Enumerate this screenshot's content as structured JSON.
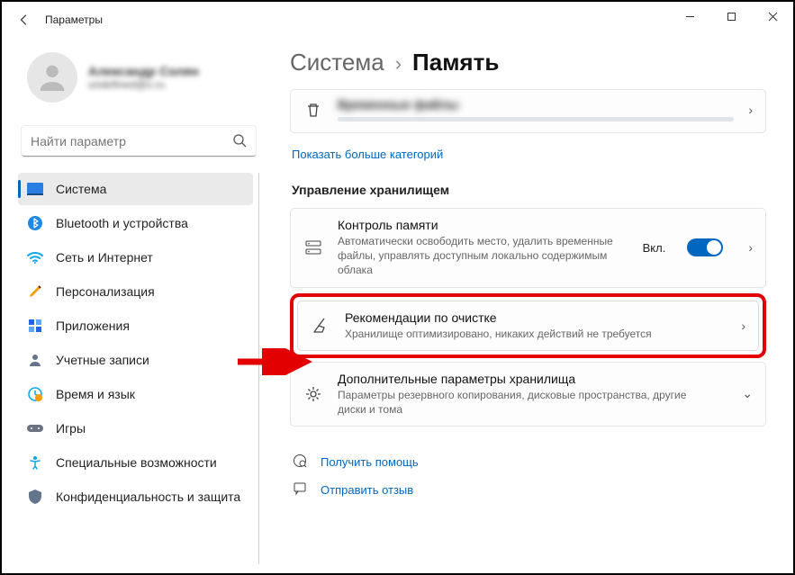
{
  "window": {
    "title": "Параметры"
  },
  "user": {
    "name": "Александр Солян",
    "email": "undefined@x.ru"
  },
  "search": {
    "placeholder": "Найти параметр"
  },
  "nav": [
    {
      "id": "system",
      "label": "Система",
      "active": true
    },
    {
      "id": "bluetooth",
      "label": "Bluetooth и устройства",
      "active": false
    },
    {
      "id": "network",
      "label": "Сеть и Интернет",
      "active": false
    },
    {
      "id": "personalize",
      "label": "Персонализация",
      "active": false
    },
    {
      "id": "apps",
      "label": "Приложения",
      "active": false
    },
    {
      "id": "accounts",
      "label": "Учетные записи",
      "active": false
    },
    {
      "id": "time",
      "label": "Время и язык",
      "active": false
    },
    {
      "id": "gaming",
      "label": "Игры",
      "active": false
    },
    {
      "id": "accessibility",
      "label": "Специальные возможности",
      "active": false
    },
    {
      "id": "privacy",
      "label": "Конфиденциальность и защита",
      "active": false
    }
  ],
  "breadcrumb": {
    "parent": "Система",
    "current": "Память"
  },
  "top_card": {
    "title": "Временные файлы"
  },
  "more_categories": "Показать больше категорий",
  "section_title": "Управление хранилищем",
  "storage_sense": {
    "title": "Контроль памяти",
    "desc": "Автоматически освободить место, удалить временные файлы, управлять доступным локально содержимым облака",
    "state_label": "Вкл."
  },
  "cleanup": {
    "title": "Рекомендации по очистке",
    "desc": "Хранилище оптимизировано, никаких действий не требуется"
  },
  "advanced": {
    "title": "Дополнительные параметры хранилища",
    "desc": "Параметры резервного копирования, дисковые пространства, другие диски и тома"
  },
  "help": {
    "get_help": "Получить помощь",
    "feedback": "Отправить отзыв"
  }
}
